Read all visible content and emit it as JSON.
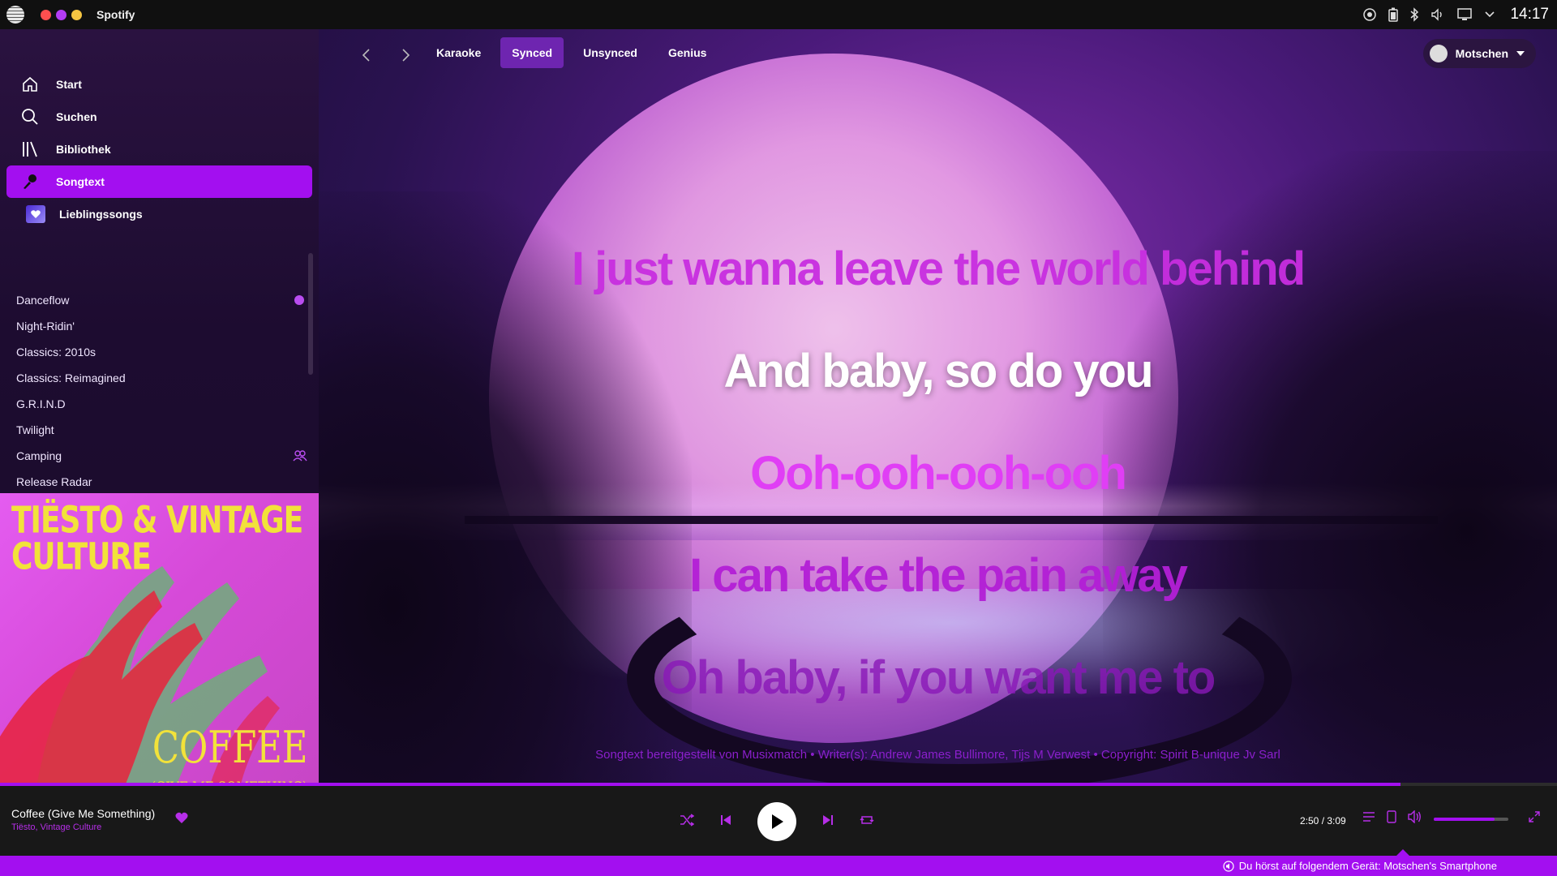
{
  "os": {
    "app_name": "Spotify",
    "clock": "14:17",
    "dot_colors": [
      "#ff4f4f",
      "#b33cf5",
      "#f5c542"
    ],
    "tray_icons": [
      "record-icon",
      "battery-icon",
      "bluetooth-icon",
      "volume-icon",
      "display-icon",
      "chevron-down-icon"
    ]
  },
  "sidebar": {
    "nav": [
      {
        "label": "Start",
        "icon": "home-icon"
      },
      {
        "label": "Suchen",
        "icon": "search-icon"
      },
      {
        "label": "Bibliothek",
        "icon": "library-icon"
      },
      {
        "label": "Songtext",
        "icon": "microphone-icon",
        "active": true
      }
    ],
    "favorites_label": "Lieblingssongs",
    "playlists": [
      {
        "label": "Danceflow",
        "badge": true
      },
      {
        "label": "Night-Ridin'"
      },
      {
        "label": "Classics: 2010s"
      },
      {
        "label": "Classics: Reimagined"
      },
      {
        "label": "G.R.I.N.D"
      },
      {
        "label": "Twilight"
      },
      {
        "label": "Camping",
        "collaborative": true
      },
      {
        "label": "Release Radar"
      }
    ],
    "cover": {
      "artist_text": "TIËSTO & VINTAGE CULTURE",
      "title_text": "COFFEE",
      "subtitle_text": "(GIVE ME SOMETHING)"
    }
  },
  "topnav": {
    "tabs": [
      {
        "label": "Karaoke"
      },
      {
        "label": "Synced",
        "active": true
      },
      {
        "label": "Unsynced"
      },
      {
        "label": "Genius"
      }
    ],
    "user": "Motschen"
  },
  "lyrics": {
    "lines": [
      "I just wanna leave the world behind",
      "And baby, so do you",
      "Ooh-ooh-ooh-ooh",
      "I can take the pain away",
      "Oh baby, if you want me to"
    ],
    "credits": "Songtext bereitgestellt von Musixmatch • Writer(s): Andrew James Bullimore, Tijs M Verwest • Copyright: Spirit B-unique Jv Sarl"
  },
  "player": {
    "title": "Coffee (Give Me Something)",
    "artist": "Tiësto, Vintage Culture",
    "time": "2:50 / 3:09",
    "progress_fraction": 0.8995,
    "volume_fraction": 0.82,
    "accent": "#a30ff0"
  },
  "device": {
    "message": "Du hörst auf folgendem Gerät: Motschen's Smartphone"
  }
}
